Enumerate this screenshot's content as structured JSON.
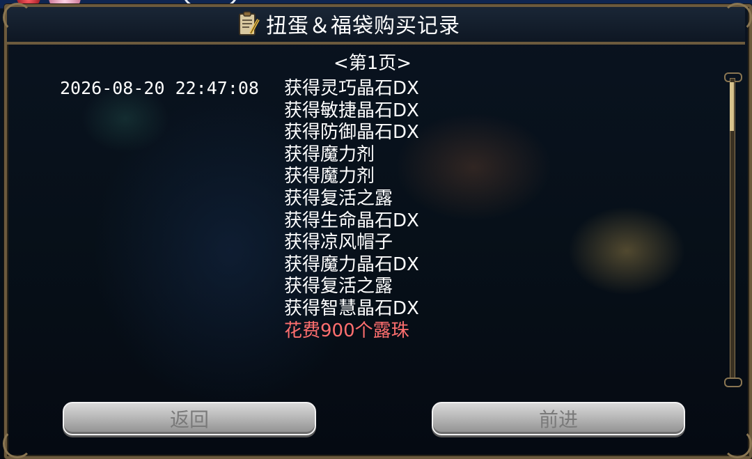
{
  "window": {
    "title": "扭蛋＆福袋购买记录",
    "title_icon": "clipboard-pencil-icon"
  },
  "pagination": {
    "label": "<第1页>"
  },
  "record": {
    "timestamp": "2026-08-20 22:47:08",
    "items": [
      "获得灵巧晶石DX",
      "获得敏捷晶石DX",
      "获得防御晶石DX",
      "获得魔力剂",
      "获得魔力剂",
      "获得复活之露",
      "获得生命晶石DX",
      "获得凉风帽子",
      "获得魔力晶石DX",
      "获得复活之露",
      "获得智慧晶石DX"
    ],
    "cost": "花费900个露珠",
    "cost_color": "#ff6f6f"
  },
  "buttons": {
    "back_label": "返回",
    "next_label": "前进"
  }
}
